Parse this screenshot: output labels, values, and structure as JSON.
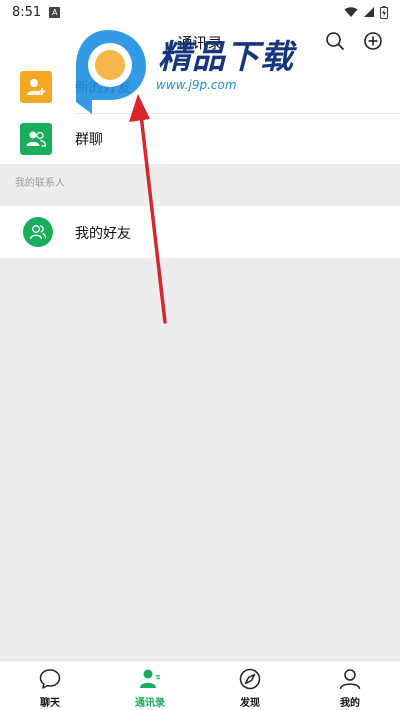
{
  "status_bar": {
    "time": "8:51",
    "notification_glyph": "A"
  },
  "header": {
    "title": "通讯录"
  },
  "contacts": {
    "items": [
      {
        "label": "新的好友",
        "icon": "add-friend-icon",
        "color": "#f5a623"
      },
      {
        "label": "群聊",
        "icon": "group-chat-icon",
        "color": "#1aad5c"
      }
    ],
    "section_label": "我的联系人",
    "friends": {
      "label": "我的好友",
      "icon": "my-friends-icon",
      "color": "#1aad5c"
    }
  },
  "watermark": {
    "brand": "精品下载",
    "url": "www.j9p.com"
  },
  "tabs": [
    {
      "label": "聊天",
      "icon": "chat-icon",
      "active": false
    },
    {
      "label": "通讯录",
      "icon": "contacts-icon",
      "active": true
    },
    {
      "label": "发现",
      "icon": "compass-icon",
      "active": false
    },
    {
      "label": "我的",
      "icon": "profile-icon",
      "active": false
    }
  ],
  "colors": {
    "accent": "#1aad5c",
    "orange": "#f5a623",
    "background": "#ededed",
    "annotation_arrow": "#d9262b"
  }
}
